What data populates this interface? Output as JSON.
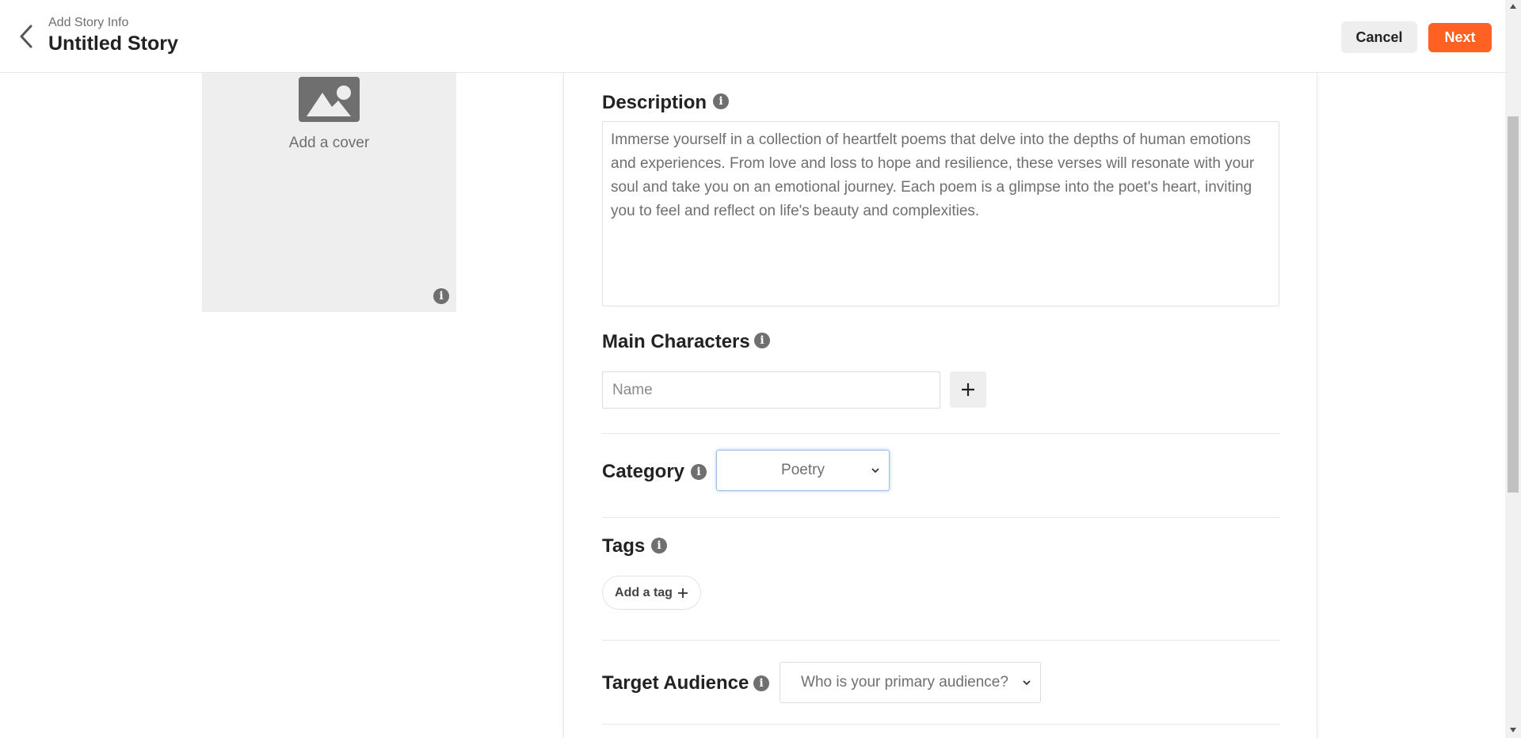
{
  "header": {
    "subtitle": "Add Story Info",
    "title": "Untitled Story",
    "cancel_label": "Cancel",
    "next_label": "Next",
    "accent_color": "#ff6122"
  },
  "cover": {
    "label": "Add a cover",
    "icon": "image-placeholder-icon"
  },
  "description": {
    "label": "Description",
    "text": "Immerse yourself in a collection of heartfelt poems that delve into the depths of human emotions and experiences. From love and loss to hope and resilience, these verses will resonate with your soul and take you on an emotional journey. Each poem is a glimpse into the poet's heart, inviting you to feel and reflect on life's beauty and complexities."
  },
  "main_characters": {
    "label": "Main Characters",
    "name_placeholder": "Name",
    "name_value": ""
  },
  "category": {
    "label": "Category",
    "selected": "Poetry"
  },
  "tags": {
    "label": "Tags",
    "add_label": "Add a tag"
  },
  "target_audience": {
    "label": "Target Audience",
    "selected": "Who is your primary audience?"
  },
  "info_icon_glyph": "i"
}
